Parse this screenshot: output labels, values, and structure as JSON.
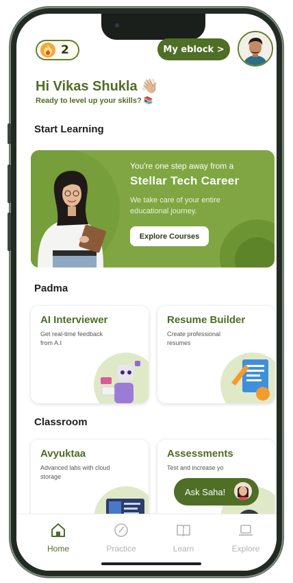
{
  "header": {
    "streak_count": "2",
    "eblock_label": "My eblock >",
    "greeting": "Hi Vikas Shukla 👋🏼",
    "subtitle": "Ready to level up your skills? 📚"
  },
  "sections": {
    "start_learning": "Start Learning",
    "padma": "Padma",
    "classroom": "Classroom"
  },
  "banner": {
    "subtitle": "You're one step away from a",
    "title": "Stellar Tech Career",
    "description": "We take care of your entire educational journey.",
    "button": "Explore Courses"
  },
  "cards": {
    "ai_interviewer": {
      "title": "AI Interviewer",
      "desc": "Get real-time feedback from A.I"
    },
    "resume_builder": {
      "title": "Resume Builder",
      "desc": "Create professional resumes"
    },
    "avyuktaa": {
      "title": "Avyuktaa",
      "desc": "Advanced labs with cloud storage"
    },
    "assessments": {
      "title": "Assessments",
      "desc": "Test and increase yo"
    }
  },
  "ask_button": "Ask Saha!",
  "nav": {
    "items": [
      {
        "label": "Home",
        "icon": "home-icon",
        "active": true
      },
      {
        "label": "Practice",
        "icon": "practice-icon",
        "active": false
      },
      {
        "label": "Learn",
        "icon": "book-icon",
        "active": false
      },
      {
        "label": "Explore",
        "icon": "laptop-icon",
        "active": false
      }
    ]
  },
  "colors": {
    "accent": "#4f6e26",
    "banner": "#7fa642",
    "accent_text": "#4e6d25"
  }
}
